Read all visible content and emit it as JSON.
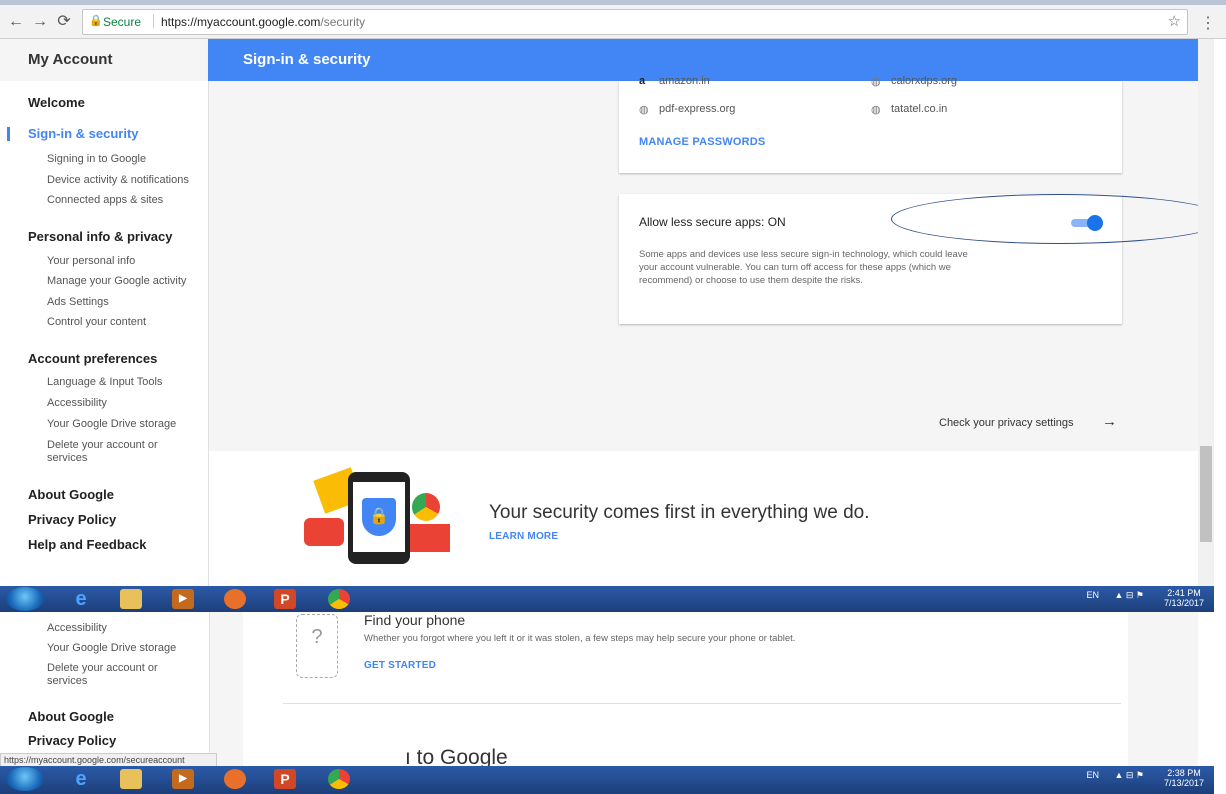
{
  "browser": {
    "secure_label": "Secure",
    "url_host": "https://myaccount.google.com",
    "url_path": "/security"
  },
  "app": {
    "title": "My Account",
    "section_title": "Sign-in & security"
  },
  "sidebar": {
    "welcome": "Welcome",
    "signin": "Sign-in & security",
    "signin_items": [
      "Signing in to Google",
      "Device activity & notifications",
      "Connected apps & sites"
    ],
    "personal": "Personal info & privacy",
    "personal_items": [
      "Your personal info",
      "Manage your Google activity",
      "Ads Settings",
      "Control your content"
    ],
    "prefs": "Account preferences",
    "prefs_items": [
      "Language & Input Tools",
      "Accessibility",
      "Your Google Drive storage",
      "Delete your account or",
      "services"
    ],
    "about": "About Google",
    "privacy": "Privacy Policy",
    "help": "Help and Feedback"
  },
  "passwords_card": {
    "sites": [
      "amazon.in",
      "calorxdps.org",
      "pdf-express.org",
      "tatatel.co.in"
    ],
    "manage_label": "MANAGE PASSWORDS"
  },
  "less_secure": {
    "title": "Allow less secure apps: ON",
    "state": "on",
    "description": [
      "Some apps and devices use less secure sign-in technology, which could leave",
      "your account vulnerable. You can turn off access for these apps (which we",
      "recommend) or choose to use them despite the risks."
    ]
  },
  "privacy_link": "Check your privacy settings",
  "banner": {
    "headline": "Your security comes first in everything we do.",
    "learn_more": "LEARN MORE"
  },
  "taskbar_top": {
    "lang": "EN",
    "time": "2:41 PM",
    "date": "7/13/2017"
  },
  "lower": {
    "sidebar_items": [
      "Accessibility",
      "Your Google Drive storage",
      "Delete your account or",
      "services"
    ],
    "about": "About Google",
    "privacy": "Privacy Policy",
    "find_title": "Find your phone",
    "find_desc": "Whether you forgot where you left it or it was stolen, a few steps may help secure your phone or tablet.",
    "get_started": "GET STARTED",
    "partial_heading": "ı to Google",
    "status_url": "https://myaccount.google.com/secureaccount"
  },
  "taskbar_bottom": {
    "lang": "EN",
    "time": "2:38 PM",
    "date": "7/13/2017"
  }
}
